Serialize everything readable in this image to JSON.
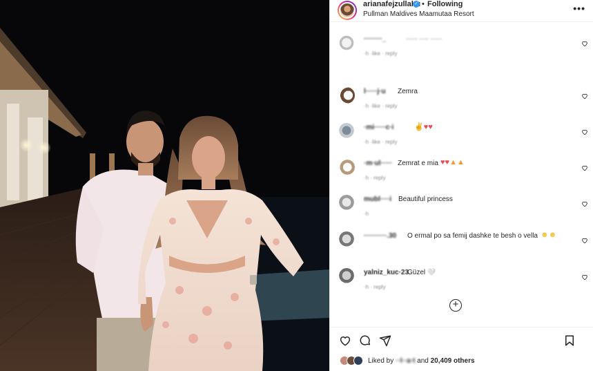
{
  "header": {
    "username": "arianafejzullahu",
    "separator": "•",
    "follow_status": "Following",
    "location": "Pullman Maldives Maamutaa Resort",
    "more_icon": "more-options-icon"
  },
  "comments": [
    {
      "user": "········_",
      "text": "····· ···· ·····",
      "meta": "·h  ·like · reply",
      "emoji": ""
    },
    {
      "user": "l·····j·u",
      "text": "Zemra",
      "meta": "·h  ·like · reply",
      "emoji": ""
    },
    {
      "user": "·mi·····c·i",
      "text": "",
      "meta": "·h  ·like · reply",
      "emoji": "hands,heart,heart"
    },
    {
      "user": "·m·ul·····",
      "text": "Zemrat e mia",
      "meta": "·h · reply",
      "emoji": "heart,heart,fire,fire"
    },
    {
      "user": "mubl····i",
      "text": "Beautiful princess",
      "meta": "·h",
      "emoji": ""
    },
    {
      "user": "··········.30",
      "text": "O ermal po sa femij dashke te besh o vella",
      "meta": "",
      "emoji": "laugh,laugh"
    },
    {
      "user": "yalniz_kuc·23",
      "text": "Güzel 🤍",
      "meta": "·h · reply",
      "emoji": ""
    }
  ],
  "actions": {
    "like_icon": "heart-outline-icon",
    "comment_icon": "comment-bubble-icon",
    "share_icon": "send-paper-plane-icon",
    "save_icon": "bookmark-icon",
    "liked_by_prefix": "Liked by",
    "liked_by_user": "··l··a·t",
    "liked_by_and": "and",
    "liked_by_count": "20,409 others"
  },
  "colors": {
    "heart_red": "#ed4956",
    "verified_blue": "#3897f0",
    "text_primary": "#262626",
    "text_secondary": "#8e8e8e"
  }
}
